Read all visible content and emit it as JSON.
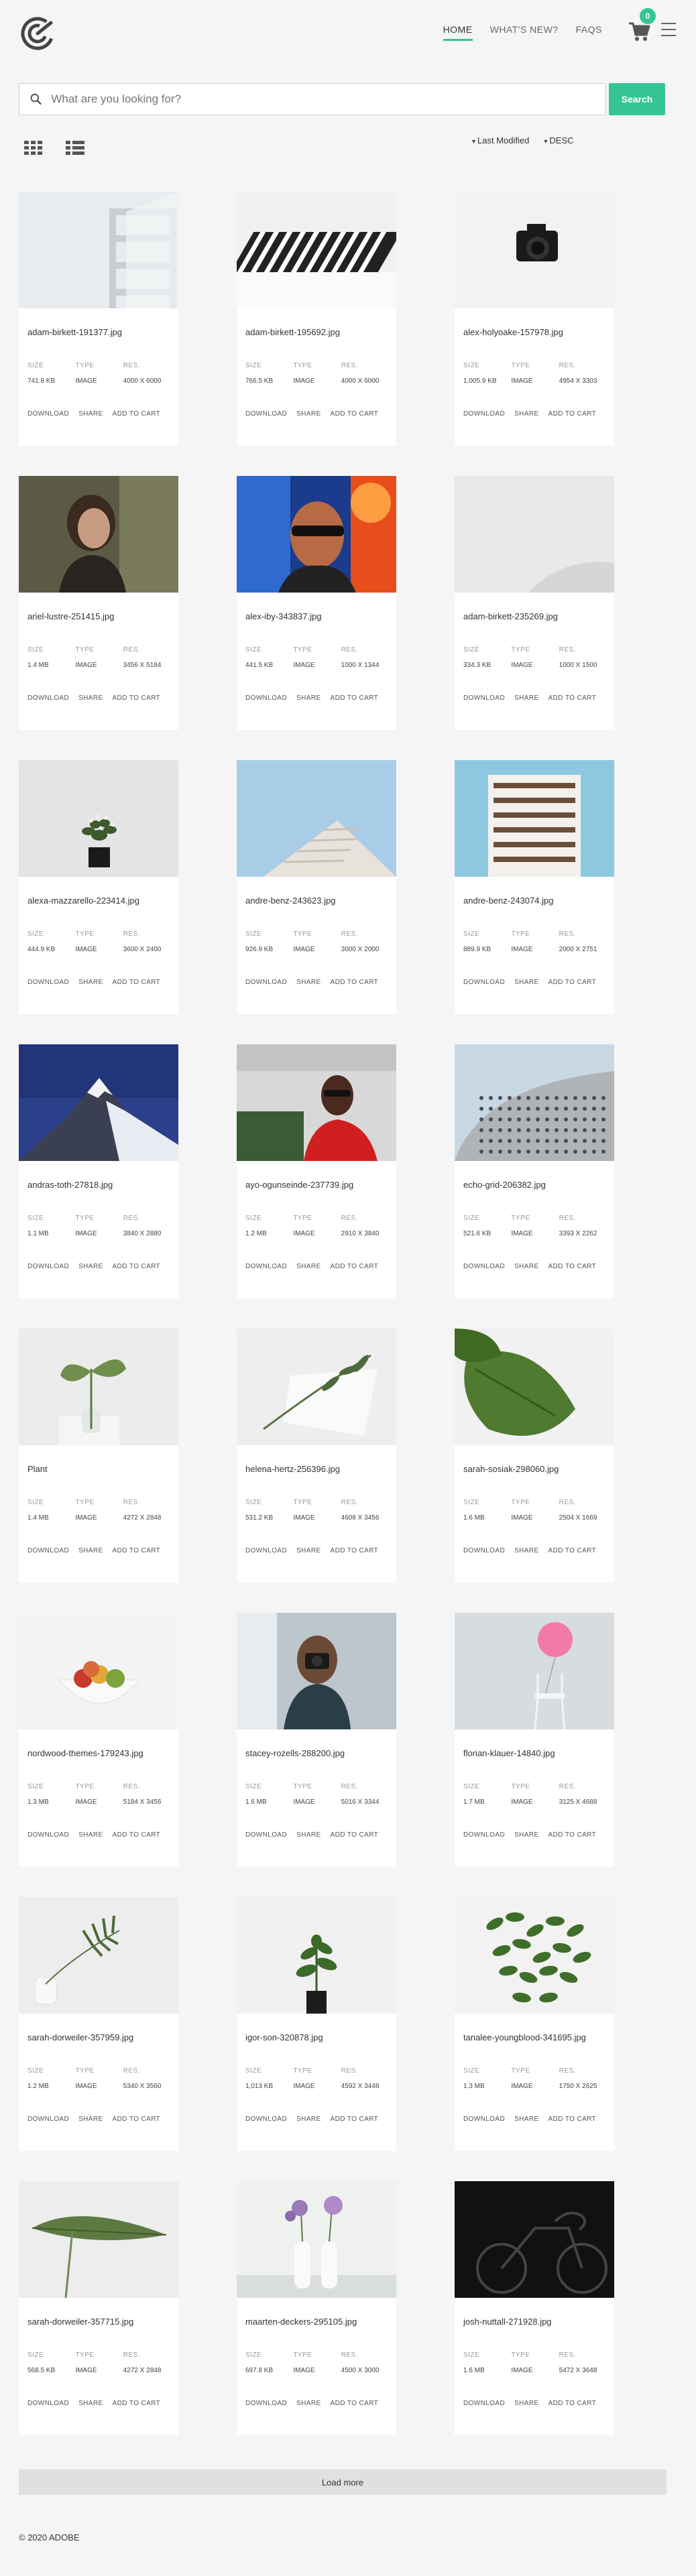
{
  "nav": {
    "items": [
      {
        "label": "HOME",
        "active": true
      },
      {
        "label": "WHAT'S NEW?",
        "active": false
      },
      {
        "label": "FAQS",
        "active": false
      }
    ],
    "cart_count": "0"
  },
  "search": {
    "placeholder": "What are you looking for?",
    "button": "Search"
  },
  "sort": {
    "field": "Last Modified",
    "order": "DESC"
  },
  "labels": {
    "size": "SIZE",
    "type": "TYPE",
    "res": "RES."
  },
  "actions": {
    "download": "DOWNLOAD",
    "share": "SHARE",
    "add_to_cart": "ADD TO CART"
  },
  "images": [
    {
      "name": "adam-birkett-191377.jpg",
      "size": "741.8 KB",
      "type": "IMAGE",
      "res": "4000 X 6000",
      "icon": "architecture-white"
    },
    {
      "name": "adam-birkett-195692.jpg",
      "size": "766.5 KB",
      "type": "IMAGE",
      "res": "4000 X 6000",
      "icon": "architecture-stripes"
    },
    {
      "name": "alex-holyoake-157978.jpg",
      "size": "1,005.9 KB",
      "type": "IMAGE",
      "res": "4954 X 3303",
      "icon": "camera"
    },
    {
      "name": "ariel-lustre-251415.jpg",
      "size": "1.4 MB",
      "type": "IMAGE",
      "res": "3456 X 5184",
      "icon": "portrait-woman"
    },
    {
      "name": "alex-iby-343837.jpg",
      "size": "441.5 KB",
      "type": "IMAGE",
      "res": "1000 X 1344",
      "icon": "portrait-neon"
    },
    {
      "name": "adam-birkett-235269.jpg",
      "size": "334.3 KB",
      "type": "IMAGE",
      "res": "1000 X 1500",
      "icon": "white-curve"
    },
    {
      "name": "alexa-mazzarello-223414.jpg",
      "size": "444.9 KB",
      "type": "IMAGE",
      "res": "3600 X 2400",
      "icon": "potted-plant"
    },
    {
      "name": "andre-benz-243623.jpg",
      "size": "926.9 KB",
      "type": "IMAGE",
      "res": "3000 X 2000",
      "icon": "building-sky"
    },
    {
      "name": "andre-benz-243074.jpg",
      "size": "889.9 KB",
      "type": "IMAGE",
      "res": "2000 X 2751",
      "icon": "building-windows"
    },
    {
      "name": "andras-toth-27818.jpg",
      "size": "1.1 MB",
      "type": "IMAGE",
      "res": "3840 X 2880",
      "icon": "mountain"
    },
    {
      "name": "ayo-ogunseinde-237739.jpg",
      "size": "1.2 MB",
      "type": "IMAGE",
      "res": "2910 X 3840",
      "icon": "portrait-red"
    },
    {
      "name": "echo-grid-206382.jpg",
      "size": "521.6 KB",
      "type": "IMAGE",
      "res": "3393 X 2262",
      "icon": "building-dots"
    },
    {
      "name": "Plant",
      "size": "1.4 MB",
      "type": "IMAGE",
      "res": "4272 X 2848",
      "icon": "monstera-vase"
    },
    {
      "name": "helena-hertz-256396.jpg",
      "size": "531.2 KB",
      "type": "IMAGE",
      "res": "4608 X 3456",
      "icon": "branch-paper"
    },
    {
      "name": "sarah-sosiak-298060.jpg",
      "size": "1.6 MB",
      "type": "IMAGE",
      "res": "2504 X 1669",
      "icon": "fiddle-leaf"
    },
    {
      "name": "nordwood-themes-179243.jpg",
      "size": "1.3 MB",
      "type": "IMAGE",
      "res": "5184 X 3456",
      "icon": "fruit-bowl"
    },
    {
      "name": "stacey-rozells-288200.jpg",
      "size": "1.6 MB",
      "type": "IMAGE",
      "res": "5016 X 3344",
      "icon": "photographer"
    },
    {
      "name": "florian-klauer-14840.jpg",
      "size": "1.7 MB",
      "type": "IMAGE",
      "res": "3125 X 4688",
      "icon": "balloon-chair"
    },
    {
      "name": "sarah-dorweiler-357959.jpg",
      "size": "1.2 MB",
      "type": "IMAGE",
      "res": "5340 X 3560",
      "icon": "palm-vase"
    },
    {
      "name": "igor-son-320878.jpg",
      "size": "1,013 KB",
      "type": "IMAGE",
      "res": "4592 X 3448",
      "icon": "plant-pot"
    },
    {
      "name": "tanalee-youngblood-341695.jpg",
      "size": "1.3 MB",
      "type": "IMAGE",
      "res": "1750 X 2625",
      "icon": "plant-bush"
    },
    {
      "name": "sarah-dorweiler-357715.jpg",
      "size": "568.5 KB",
      "type": "IMAGE",
      "res": "4272 X 2848",
      "icon": "leaf"
    },
    {
      "name": "maarten-deckers-295105.jpg",
      "size": "697.8 KB",
      "type": "IMAGE",
      "res": "4500 X 3000",
      "icon": "flower-vases"
    },
    {
      "name": "josh-nuttall-271928.jpg",
      "size": "1.6 MB",
      "type": "IMAGE",
      "res": "5472 X 3648",
      "icon": "bicycle-dark"
    }
  ],
  "load_more": "Load more",
  "footer": "© 2020 ADOBE",
  "colors": {
    "accent": "#35c495",
    "background": "#f5f5f5"
  }
}
